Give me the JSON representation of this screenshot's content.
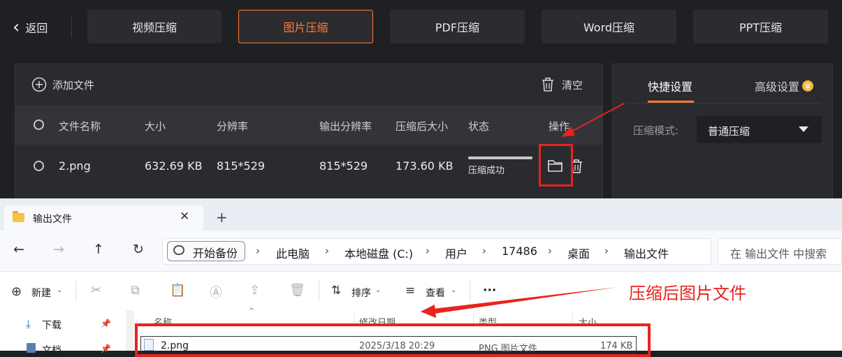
{
  "app": {
    "back_label": "返回",
    "tabs": [
      {
        "label": "视频压缩",
        "active": false
      },
      {
        "label": "图片压缩",
        "active": true
      },
      {
        "label": "PDF压缩",
        "active": false
      },
      {
        "label": "Word压缩",
        "active": false
      },
      {
        "label": "PPT压缩",
        "active": false
      }
    ],
    "toolbar": {
      "add_file": "添加文件",
      "clear": "清空"
    },
    "columns": [
      "文件名称",
      "大小",
      "分辨率",
      "输出分辨率",
      "压缩后大小",
      "状态",
      "操作"
    ],
    "files": [
      {
        "name": "2.png",
        "size": "632.69 KB",
        "resolution": "815*529",
        "output_resolution": "815*529",
        "compressed_size": "173.60 KB",
        "status": "压缩成功",
        "progress": 1.0
      }
    ],
    "settings": {
      "tabs": [
        "快捷设置",
        "高级设置"
      ],
      "mode_label": "压缩模式:",
      "mode_value": "普通压缩"
    }
  },
  "explorer": {
    "tab_title": "输出文件",
    "backup_label": "开始备份",
    "breadcrumbs": [
      "此电脑",
      "本地磁盘 (C:)",
      "用户",
      "17486",
      "桌面",
      "输出文件"
    ],
    "search_placeholder": "在 输出文件 中搜索",
    "toolbar": {
      "new": "新建",
      "sort": "排序",
      "view": "查看",
      "more": "···"
    },
    "sidebar": [
      "下载",
      "文档"
    ],
    "columns": [
      "名称",
      "修改日期",
      "类型",
      "大小"
    ],
    "files": [
      {
        "name": "2.png",
        "modified": "2025/3/18 20:29",
        "type": "PNG 图片文件",
        "size": "174 KB"
      }
    ]
  },
  "annotation": {
    "label": "压缩后图片文件",
    "color": "#e8231d"
  },
  "colors": {
    "accent": "#ff7b3a",
    "annotation_red": "#e8231d",
    "app_bg": "#1f2023"
  }
}
